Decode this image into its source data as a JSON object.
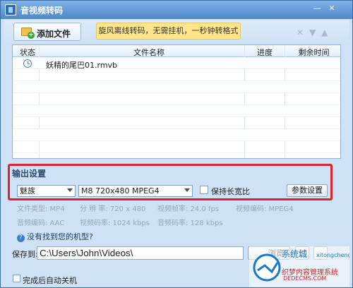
{
  "window": {
    "title": "音视频转码"
  },
  "toolbar": {
    "add_file_label": "添加文件",
    "notice": "旋风离线转码，无需挂机，一秒钟转格式"
  },
  "table": {
    "headers": {
      "status": "状态",
      "filename": "文件名称",
      "progress": "进度",
      "remaining": "剩余时间"
    },
    "rows": [
      {
        "status_icon": "clock-icon",
        "filename": "妖精的尾巴01.rmvb",
        "progress": "",
        "remaining": ""
      }
    ]
  },
  "output": {
    "section_title": "输出设置",
    "device": "魅族",
    "format": "M8 720x480 MPEG4",
    "keep_ratio_label": "保持长宽比",
    "param_button": "参数设置",
    "info": {
      "file_type": "文件类型:  MP4",
      "resolution": "分 辨 率:  720 x 480",
      "video_fps": "视频帧率:  24.0 fps",
      "video_codec": "视频编码:  MPEG4",
      "audio_codec": "音频编码:  AAC",
      "video_bitrate": "视频码率:  1024 kbps",
      "audio_bitrate": "音频码率:  128 kbps"
    },
    "help_link": "没有找到您的机型?"
  },
  "save": {
    "label": "保存到:",
    "path": "C:\\Users\\John\\Videos\\",
    "browse_label": "浏览"
  },
  "footer": {
    "shutdown_label": "完成后自动关机"
  },
  "watermark": {
    "line1": "织梦内容管理系统",
    "line2": "DEDECMS.COM"
  },
  "colors": {
    "highlight": "#e0222f",
    "titlebar": "#4f88c9",
    "notice": "#ffe68b"
  }
}
